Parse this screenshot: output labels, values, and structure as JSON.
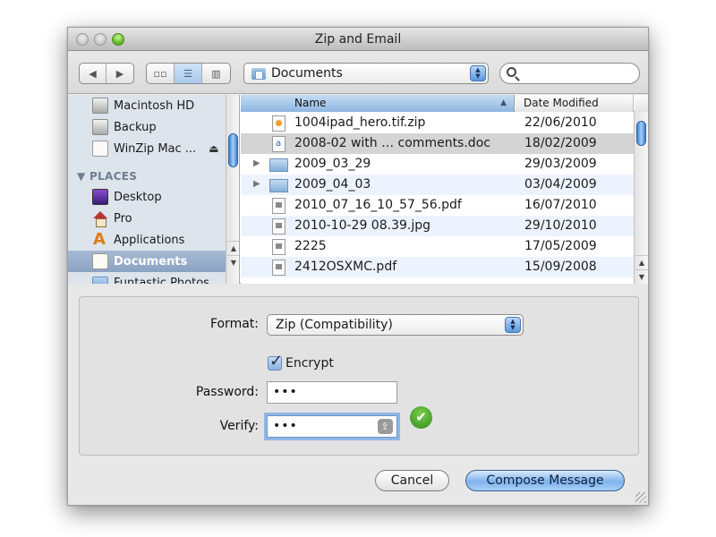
{
  "window": {
    "title": "Zip and Email",
    "traffic_lights": [
      "close",
      "minimize",
      "zoom"
    ]
  },
  "toolbar": {
    "back_icon": "◀",
    "forward_icon": "▶",
    "view_modes": [
      {
        "name": "icon-view",
        "glyph": "▫▫",
        "active": false
      },
      {
        "name": "list-view",
        "glyph": "☰",
        "active": true
      },
      {
        "name": "column-view",
        "glyph": "▥",
        "active": false
      }
    ],
    "location": "Documents",
    "search_placeholder": ""
  },
  "sidebar": {
    "devices": [
      {
        "label": "Macintosh HD",
        "icon": "disk"
      },
      {
        "label": "Backup",
        "icon": "disk"
      },
      {
        "label": "WinZip Mac ...",
        "icon": "removable-disk",
        "eject": "⏏"
      }
    ],
    "places_header": "▼ PLACES",
    "places": [
      {
        "label": "Desktop",
        "icon": "desktop"
      },
      {
        "label": "Pro",
        "icon": "home"
      },
      {
        "label": "Applications",
        "icon": "applications"
      },
      {
        "label": "Documents",
        "icon": "documents",
        "selected": true
      },
      {
        "label": "Funtastic Photos",
        "icon": "folder"
      }
    ]
  },
  "file_list": {
    "columns": {
      "name": "Name",
      "date": "Date Modified",
      "sort_indicator": "▲"
    },
    "rows": [
      {
        "name": "1004ipad_hero.tif.zip",
        "date": "22/06/2010",
        "kind": "zip",
        "expandable": false
      },
      {
        "name": "2008-02 with … comments.doc",
        "date": "18/02/2009",
        "kind": "doc",
        "expandable": false,
        "highlighted": true
      },
      {
        "name": "2009_03_29",
        "date": "29/03/2009",
        "kind": "folder",
        "expandable": true
      },
      {
        "name": "2009_04_03",
        "date": "03/04/2009",
        "kind": "folder",
        "expandable": true
      },
      {
        "name": "2010_07_16_10_57_56.pdf",
        "date": "16/07/2010",
        "kind": "img",
        "expandable": false
      },
      {
        "name": "2010-10-29 08.39.jpg",
        "date": "29/10/2010",
        "kind": "img",
        "expandable": false
      },
      {
        "name": "2225",
        "date": "17/05/2009",
        "kind": "img",
        "expandable": false
      },
      {
        "name": "2412OSXMC.pdf",
        "date": "15/09/2008",
        "kind": "img",
        "expandable": false
      }
    ]
  },
  "options": {
    "format_label": "Format:",
    "format_value": "Zip (Compatibility)",
    "encrypt_label": "Encrypt",
    "encrypt_checked": true,
    "password_label": "Password:",
    "password_value": "•••",
    "verify_label": "Verify:",
    "verify_value": "•••",
    "capslock_icon": "⇪",
    "match_icon": "✔"
  },
  "buttons": {
    "cancel": "Cancel",
    "compose": "Compose Message"
  }
}
